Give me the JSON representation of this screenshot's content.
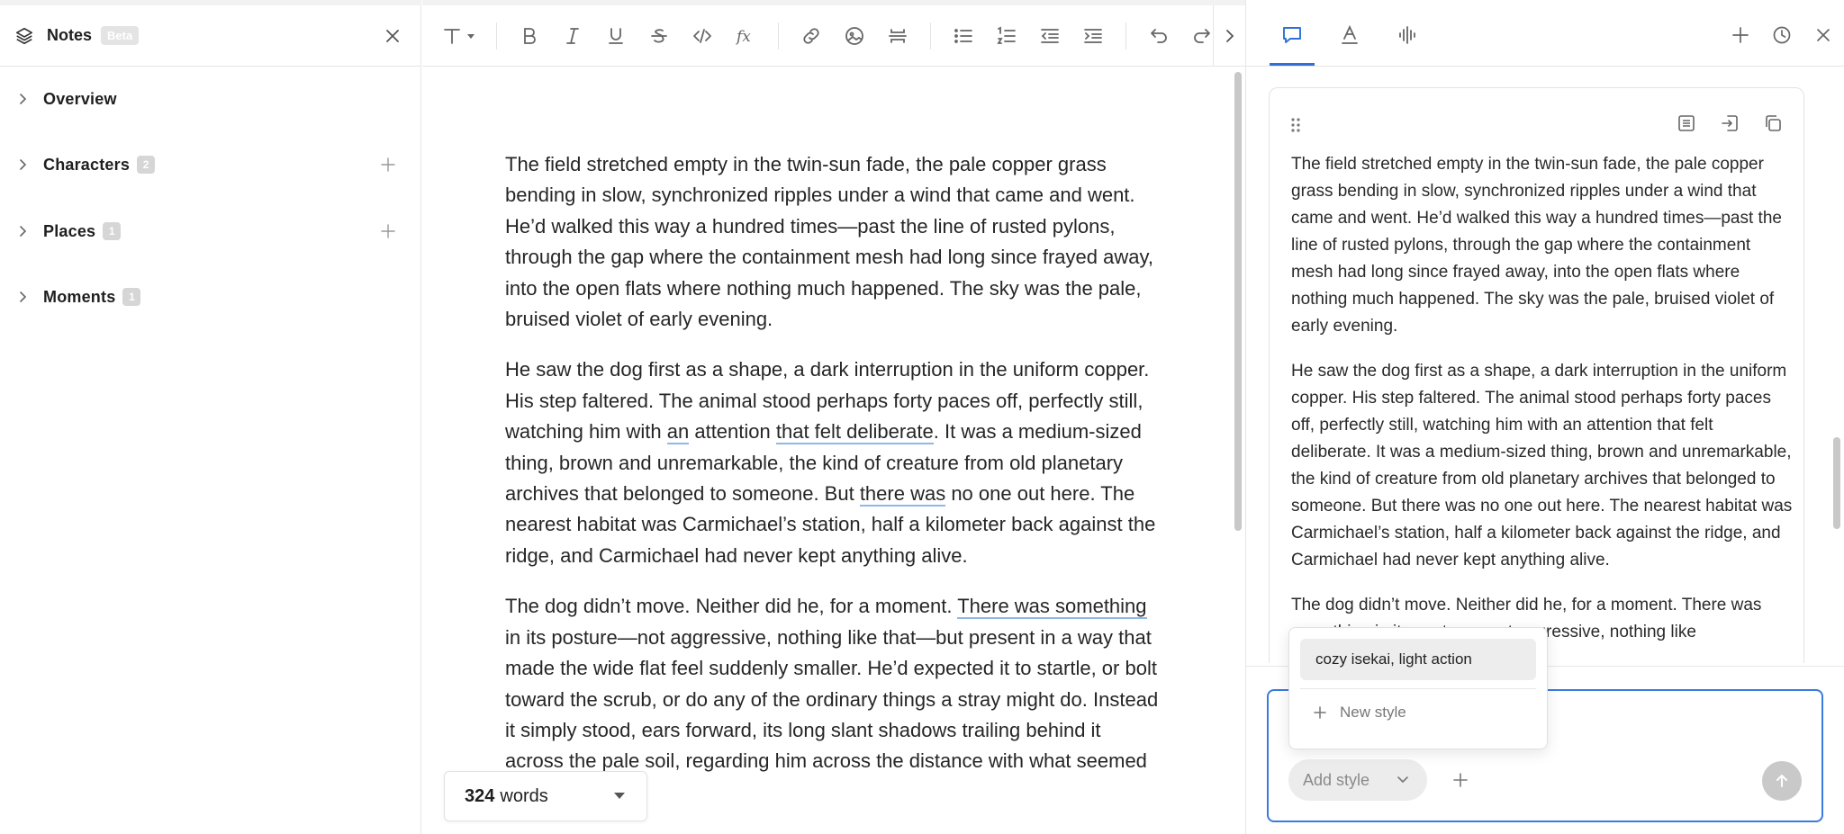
{
  "sidebar": {
    "title": "Notes",
    "badge": "Beta",
    "items": [
      {
        "label": "Overview",
        "count": ""
      },
      {
        "label": "Characters",
        "count": "2"
      },
      {
        "label": "Places",
        "count": "1"
      },
      {
        "label": "Moments",
        "count": "1"
      }
    ]
  },
  "toolbar": {
    "icons": [
      "text-style-icon",
      "bold-icon",
      "italic-icon",
      "underline-icon",
      "strikethrough-icon",
      "code-icon",
      "formula-icon",
      "link-icon",
      "image-icon",
      "divider-icon",
      "bullet-list-icon",
      "numbered-list-icon",
      "outdent-icon",
      "indent-icon",
      "undo-icon",
      "redo-icon",
      "chevron-right-icon"
    ]
  },
  "editor": {
    "p1": "The field stretched empty in the twin-sun fade, the pale copper grass bending in slow, synchronized ripples under a wind that came and went. He’d walked this way a hundred times—past the line of rusted pylons, through the gap where the containment mesh had long since frayed away, into the open flats where nothing much happened. The sky was the pale, bruised violet of early evening.",
    "p2": {
      "a": "He saw the dog first as a shape, a dark interruption in the uniform copper. His step faltered. The animal stood perhaps forty paces off, perfectly still, watching him with ",
      "u1": "an",
      "b": " attention ",
      "u2": "that felt deliberate",
      "c": ". It was a medium-sized thing, brown and unremarkable, the kind of creature from old planetary archives that belonged to someone. But ",
      "u3": "there was",
      "d": " no one out here. The nearest habitat was Carmichael’s station, half a kilometer back against the ridge, and Carmichael had never kept anything alive."
    },
    "p3": {
      "a": "The dog didn’t move. Neither did he, for a moment. ",
      "u1": "There was something",
      "b": " in its posture—not aggressive, nothing like that—but present in a way that made the wide flat feel suddenly smaller. He’d expected it to startle, or bolt toward the scrub, or do any of the ordinary things a stray might do. Instead it simply stood, ears forward, its long slant shadows trailing behind it across the pale soil, regarding him across the distance with what seemed like patience."
    }
  },
  "wordcount": {
    "number": "324",
    "label": "words"
  },
  "panel": {
    "tabs": [
      "chat-icon",
      "text-color-icon",
      "audio-waveform-icon"
    ],
    "actions": [
      "plus-icon",
      "history-icon",
      "close-icon"
    ],
    "card": {
      "p1": "The field stretched empty in the twin-sun fade, the pale copper grass bending in slow, synchronized ripples under a wind that came and went. He’d walked this way a hundred times—past the line of rusted pylons, through the gap where the containment mesh had long since frayed away, into the open flats where nothing much happened. The sky was the pale, bruised violet of early evening.",
      "p2": "He saw the dog first as a shape, a dark interruption in the uniform copper. His step faltered. The animal stood perhaps forty paces off, perfectly still, watching him with an attention that felt deliberate. It was a medium-sized thing, brown and unremarkable, the kind of creature from old planetary archives that belonged to someone. But there was no one out here. The nearest habitat was Carmichael’s station, half a kilometer back against the ridge, and Carmichael had never kept anything alive.",
      "p3": "The dog didn’t move. Neither did he, for a moment. There was something in its posture—not aggressive, nothing like"
    },
    "style_popup": {
      "option": "cozy isekai, light action",
      "new_style": "New style"
    },
    "composer": {
      "add_style": "Add style"
    }
  },
  "colors": {
    "accent": "#2f6fd6",
    "underline": "#8fb8e8"
  }
}
